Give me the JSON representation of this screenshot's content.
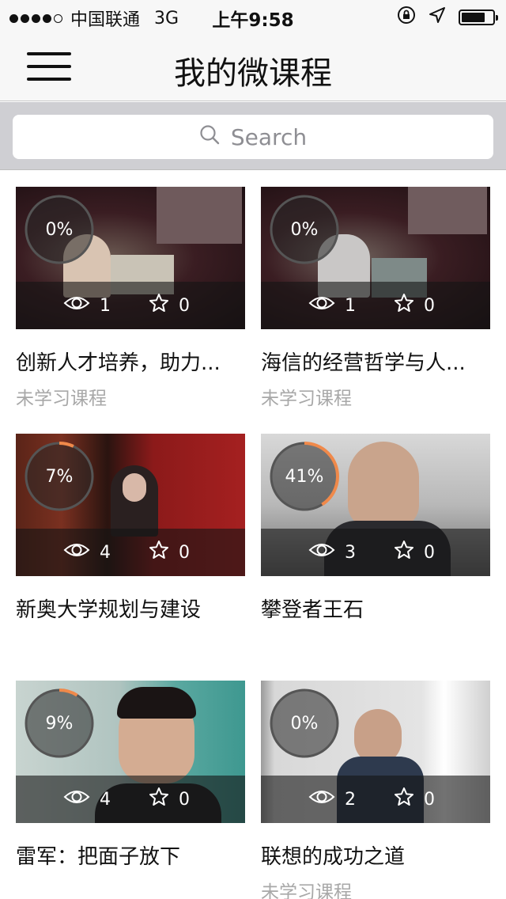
{
  "status_bar": {
    "carrier": "中国联通",
    "network": "3G",
    "time": "上午9:58",
    "signal_dots": 4,
    "battery_level": 0.75
  },
  "nav": {
    "title": "我的微课程",
    "menu_icon": "hamburger-menu-icon"
  },
  "search": {
    "placeholder": "Search",
    "icon": "search-icon"
  },
  "colors": {
    "progress_ring": "#f0894a",
    "ring_track": "#555555",
    "status_text": "#a8a8a8"
  },
  "courses": [
    {
      "progress": "0%",
      "progress_value": 0,
      "views": "1",
      "favorites": "0",
      "title": "创新人才培养，助力...",
      "status": "未学习课程"
    },
    {
      "progress": "0%",
      "progress_value": 0,
      "views": "1",
      "favorites": "0",
      "title": "海信的经营哲学与人...",
      "status": "未学习课程"
    },
    {
      "progress": "7%",
      "progress_value": 7,
      "views": "4",
      "favorites": "0",
      "title": "新奥大学规划与建设",
      "status": ""
    },
    {
      "progress": "41%",
      "progress_value": 41,
      "views": "3",
      "favorites": "0",
      "title": "攀登者王石",
      "status": ""
    },
    {
      "progress": "9%",
      "progress_value": 9,
      "views": "4",
      "favorites": "0",
      "title": "雷军：把面子放下",
      "status": ""
    },
    {
      "progress": "0%",
      "progress_value": 0,
      "views": "2",
      "favorites": "0",
      "title": "联想的成功之道",
      "status": "未学习课程"
    }
  ]
}
